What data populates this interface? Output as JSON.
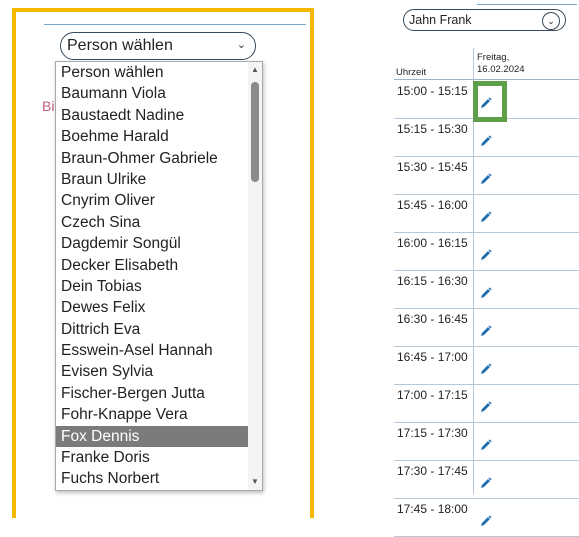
{
  "left": {
    "select_value": "Person wählen",
    "hint_visible": "Bit",
    "options": [
      "Person wählen",
      "Baumann Viola",
      "Baustaedt Nadine",
      "Boehme Harald",
      "Braun-Ohmer Gabriele",
      "Braun Ulrike",
      "Cnyrim Oliver",
      "Czech Sina",
      "Dagdemir Songül",
      "Decker Elisabeth",
      "Dein Tobias",
      "Dewes Felix",
      "Dittrich Eva",
      "Esswein-Asel Hannah",
      "Evisen Sylvia",
      "Fischer-Bergen Jutta",
      "Fohr-Knappe Vera",
      "Fox Dennis",
      "Franke Doris",
      "Fuchs Norbert"
    ],
    "selected_option": "Fox Dennis"
  },
  "right": {
    "select_value": "Jahn Frank",
    "time_header": "Uhrzeit",
    "day_header_line1": "Freitag,",
    "day_header_line2": "16.02.2024",
    "slots": [
      "15:00 - 15:15",
      "15:15 - 15:30",
      "15:30 - 15:45",
      "15:45 - 16:00",
      "16:00 - 16:15",
      "16:15 - 16:30",
      "16:30 - 16:45",
      "16:45 - 17:00",
      "17:00 - 17:15",
      "17:15 - 17:30",
      "17:30 - 17:45",
      "17:45 - 18:00"
    ],
    "highlighted_slot": "15:00 - 15:15"
  },
  "colors": {
    "frame_yellow": "#f5b800",
    "highlight_green": "#5ea04a",
    "edit_icon_blue": "#1f6bb0",
    "selected_bg": "#7b7b7b",
    "hint_pink": "#c0607a"
  },
  "icons": {
    "edit": "pencil-icon",
    "dropdown": "chevron-down-icon"
  }
}
